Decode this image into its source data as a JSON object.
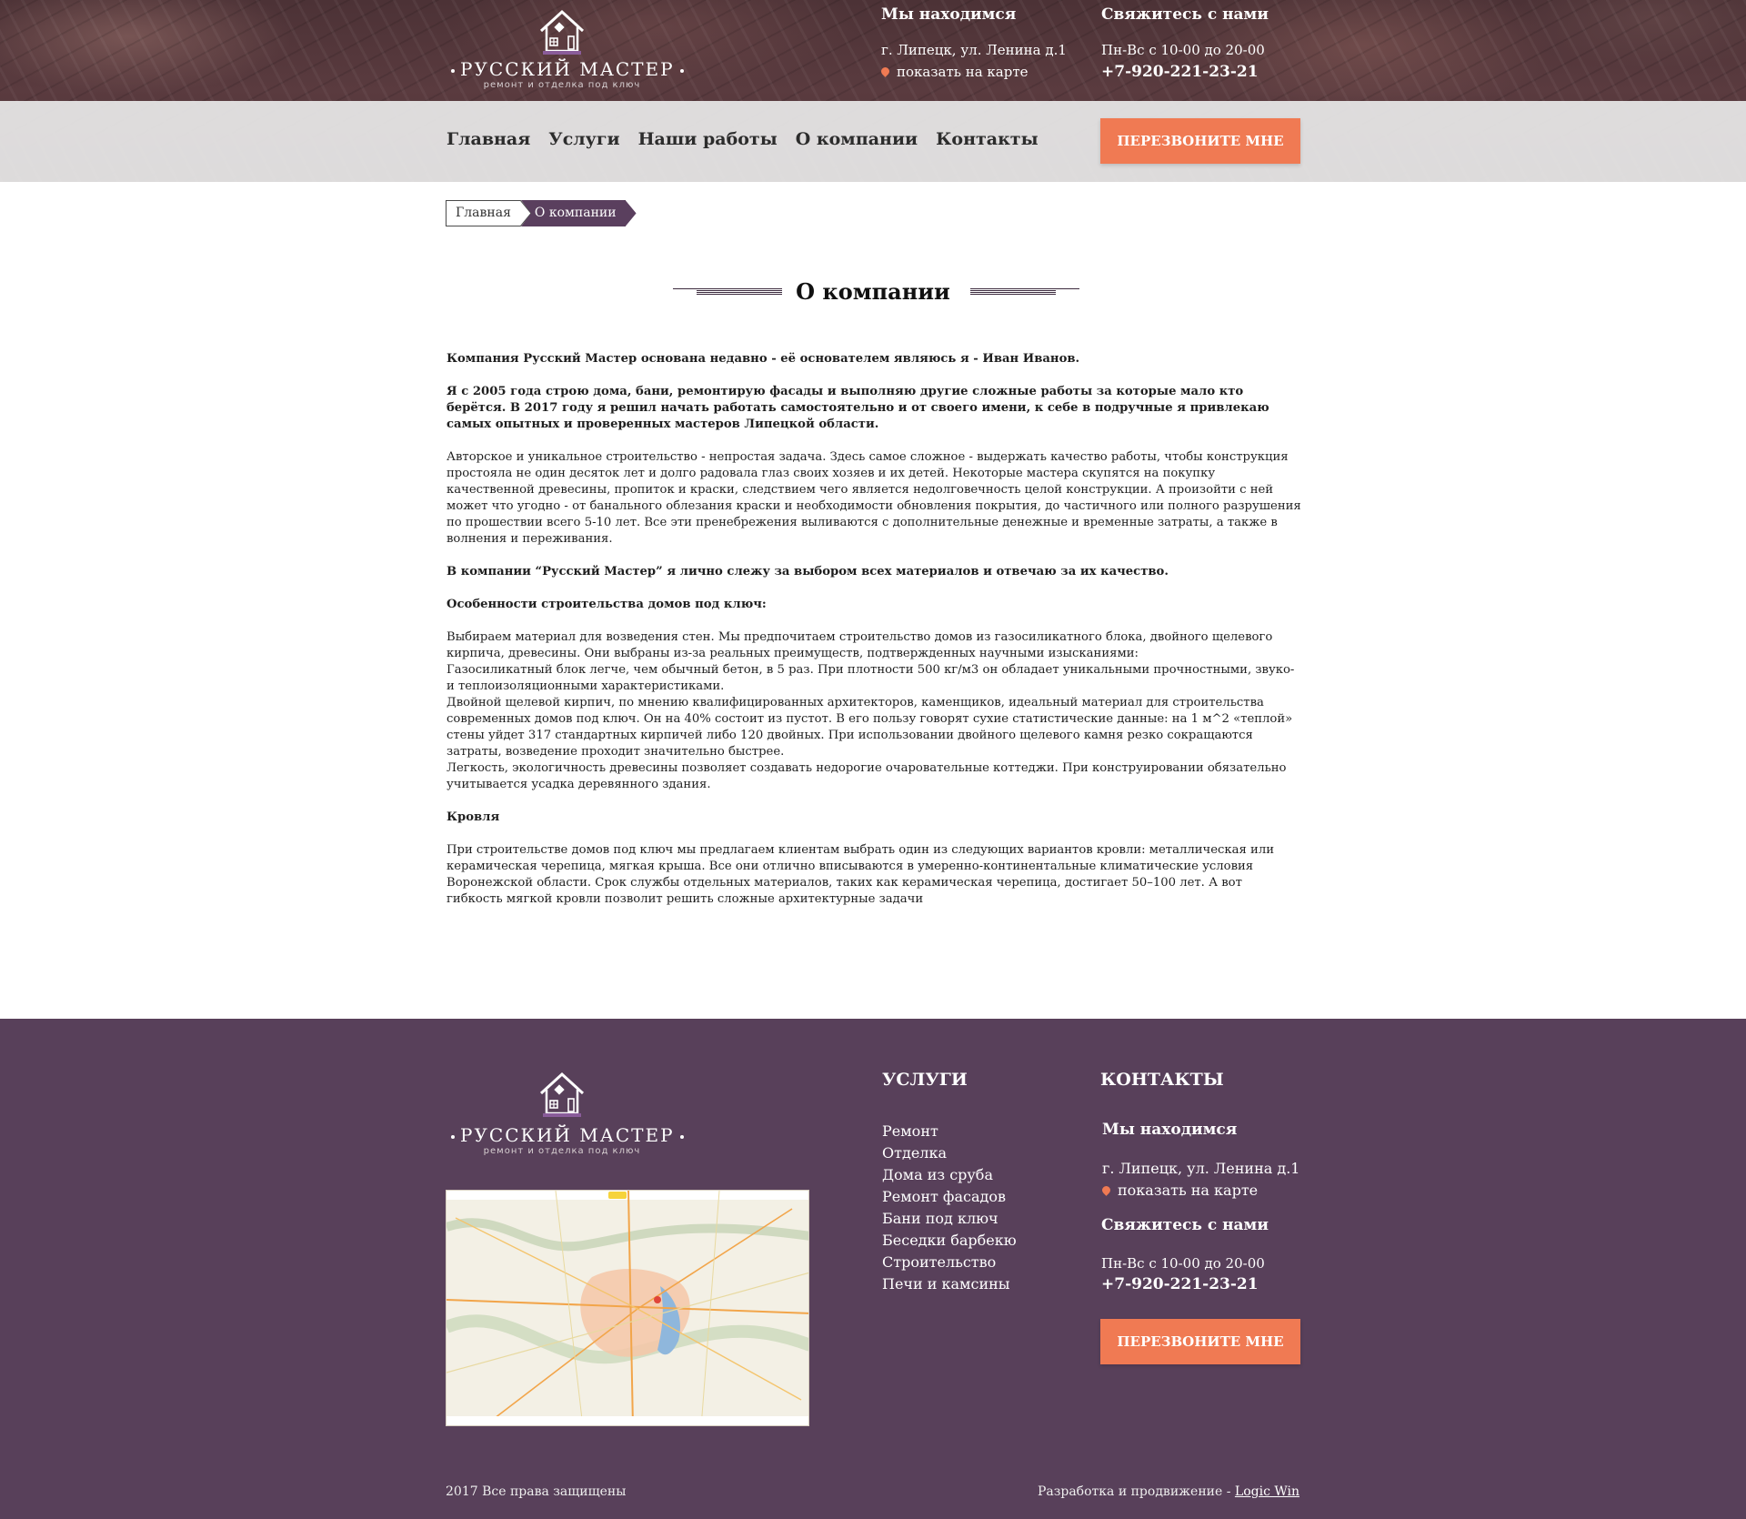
{
  "header": {
    "logo": {
      "title": "РУССКИЙ МАСТЕР",
      "subtitle": "ремонт и отделка под ключ"
    },
    "location": {
      "title": "Мы находимся",
      "address": "г. Липецк, ул. Ленина д.1",
      "map_link": "показать на карте"
    },
    "contact": {
      "title": "Свяжитесь с нами",
      "hours": "Пн-Вс с 10-00 до 20-00",
      "phone": "+7-920-221-23-21"
    },
    "callback_button": "ПЕРЕЗВОНИТЕ МНЕ"
  },
  "nav": [
    "Главная",
    "Услуги",
    "Наши работы",
    "О компании",
    "Контакты"
  ],
  "breadcrumb": {
    "home": "Главная",
    "current": "О компании"
  },
  "page_title": "О компании",
  "content": [
    {
      "bold": true,
      "text": "Компания Русский Мастер основана недавно - её основателем являюсь я - Иван Иванов."
    },
    {
      "bold": true,
      "text": "Я с 2005 года строю дома, бани, ремонтирую фасады и выполняю другие сложные работы за которые мало кто берётся. В 2017 году я решил начать работать самостоятельно и от своего имени, к себе в подручные я привлекаю самых опытных и проверенных мастеров Липецкой области."
    },
    {
      "bold": false,
      "text": "Авторское и уникальное строительство - непростая задача. Здесь самое сложное - выдержать качество работы, чтобы конструкция простояла не один десяток лет и долго радовала глаз своих хозяев и их детей. Некоторые мастера скупятся на покупку качественной древесины, пропиток и краски, следствием чего является недолговечность целой конструкции. А произойти с ней может что угодно - от банального облезания краски и необходимости обновления покрытия, до частичного или полного разрушения по прошествии всего 5-10 лет. Все эти пренебрежения выливаются с дополнительные денежные и временные затраты, а также в волнения и переживания."
    },
    {
      "bold": true,
      "text": "В компании “Русский Мастер” я лично слежу за выбором всех материалов и отвечаю за их качество."
    },
    {
      "bold": true,
      "text": "Особенности строительства домов под ключ:"
    },
    {
      "bold": false,
      "text": "Выбираем материал для возведения стен. Мы предпочитаем строительство домов из газосиликатного блока, двойного щелевого кирпича, древесины. Они выбраны из-за реальных преимуществ, подтвержденных научными изысканиями:\nГазосиликатный блок легче, чем обычный бетон, в 5 раз. При плотности 500 кг/м3 он обладает уникальными прочностными, звуко- и теплоизоляционными характеристиками.\nДвойной щелевой кирпич, по мнению квалифицированных архитекторов, каменщиков, идеальный материал для строительства современных домов под ключ. Он на 40% состоит из пустот. В его пользу говорят сухие статистические данные: на 1 м^2 «теплой» стены уйдет 317 стандартных кирпичей либо 120 двойных. При использовании двойного щелевого камня резко сокращаются затраты, возведение проходит значительно быстрее.\nЛегкость, экологичность древесины позволяет создавать недорогие очаровательные коттеджи. При конструировании обязательно учитывается усадка деревянного здания."
    },
    {
      "bold": true,
      "text": "Кровля"
    },
    {
      "bold": false,
      "text": "При строительстве домов под ключ мы предлагаем клиентам выбрать один из следующих вариантов кровли: металлическая или керамическая черепица, мягкая крыша. Все они отлично вписываются в умеренно-континентальные климатические условия Воронежской области. Срок службы отдельных материалов, таких как керамическая черепица, достигает 50–100 лет. А вот гибкость мягкой кровли позволит решить сложные архитектурные задачи"
    }
  ],
  "footer": {
    "logo": {
      "title": "РУССКИЙ МАСТЕР",
      "subtitle": "ремонт и отделка под ключ"
    },
    "services_title": "УСЛУГИ",
    "services": [
      "Ремонт",
      "Отделка",
      "Дома из сруба",
      "Ремонт фасадов",
      "Бани под ключ",
      "Беседки барбекю",
      "Строительство",
      "Печи и камсины"
    ],
    "contacts_title": "КОНТАКТЫ",
    "location": {
      "title": "Мы находимся",
      "address": "г. Липецк, ул. Ленина д.1",
      "map_link": "показать на карте"
    },
    "contact": {
      "title": "Свяжитесь с нами",
      "hours": "Пн-Вс с 10-00 до 20-00",
      "phone": "+7-920-221-23-21"
    },
    "callback_button": "ПЕРЕЗВОНИТЕ МНЕ",
    "copyright": "2017 Все права защищены",
    "dev_text": "Разработка и продвижение -",
    "dev_link": "Logic Win"
  },
  "colors": {
    "accent": "#f07a53",
    "brand_purple": "#58405a",
    "crumb_active": "#5a3f5e"
  },
  "icons": [
    "house-logo-icon",
    "map-pin-icon"
  ]
}
